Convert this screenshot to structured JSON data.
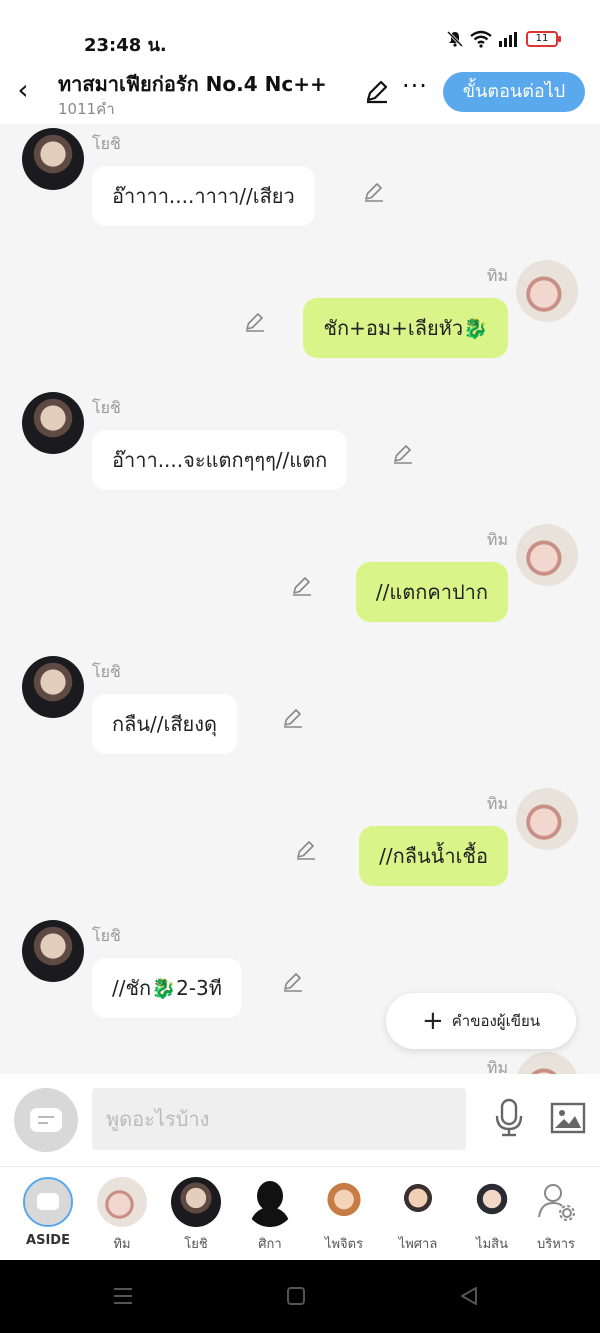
{
  "status_bar": {
    "time": "23:48 น.",
    "battery": "11"
  },
  "header": {
    "title": "ทาสมาเฟียก่อรัก No.4 Nc++",
    "word_count": "1011คำ",
    "next_button": "ขั้นตอนต่อไป"
  },
  "messages": [
    {
      "sender": "โยชิ",
      "side": "left",
      "text": "อ๊าาาา....าาาา//เสียว"
    },
    {
      "sender": "ทิม",
      "side": "right",
      "text": "ชัก+อม+เลียหัว🐉"
    },
    {
      "sender": "โยชิ",
      "side": "left",
      "text": "อ๊าาา....จะแตกๆๆๆ//แตก"
    },
    {
      "sender": "ทิม",
      "side": "right",
      "text": "//แตกคาปาก"
    },
    {
      "sender": "โยชิ",
      "side": "left",
      "text": "กลืน//เสียงดุ"
    },
    {
      "sender": "ทิม",
      "side": "right",
      "text": "//กลืนน้ำเชื้อ"
    },
    {
      "sender": "โยชิ",
      "side": "left",
      "text": "//ชัก🐉2-3ที"
    },
    {
      "sender": "ทิม",
      "side": "right",
      "text": ""
    }
  ],
  "author_note_button": "คำของผู้เขียน",
  "input": {
    "placeholder": "พูดอะไรบ้าง"
  },
  "characters": [
    {
      "name": "ASIDE"
    },
    {
      "name": "ทิม"
    },
    {
      "name": "โยชิ"
    },
    {
      "name": "ศิกา"
    },
    {
      "name": "ไพจิตร"
    },
    {
      "name": "ไพศาล"
    },
    {
      "name": "ไมสิน"
    },
    {
      "name": "บริหาร"
    }
  ],
  "colors": {
    "accent": "#5aa9ec",
    "right_bubble": "#d9f58a",
    "left_bubble": "#ffffff",
    "chat_background": "#f5f5f5"
  }
}
